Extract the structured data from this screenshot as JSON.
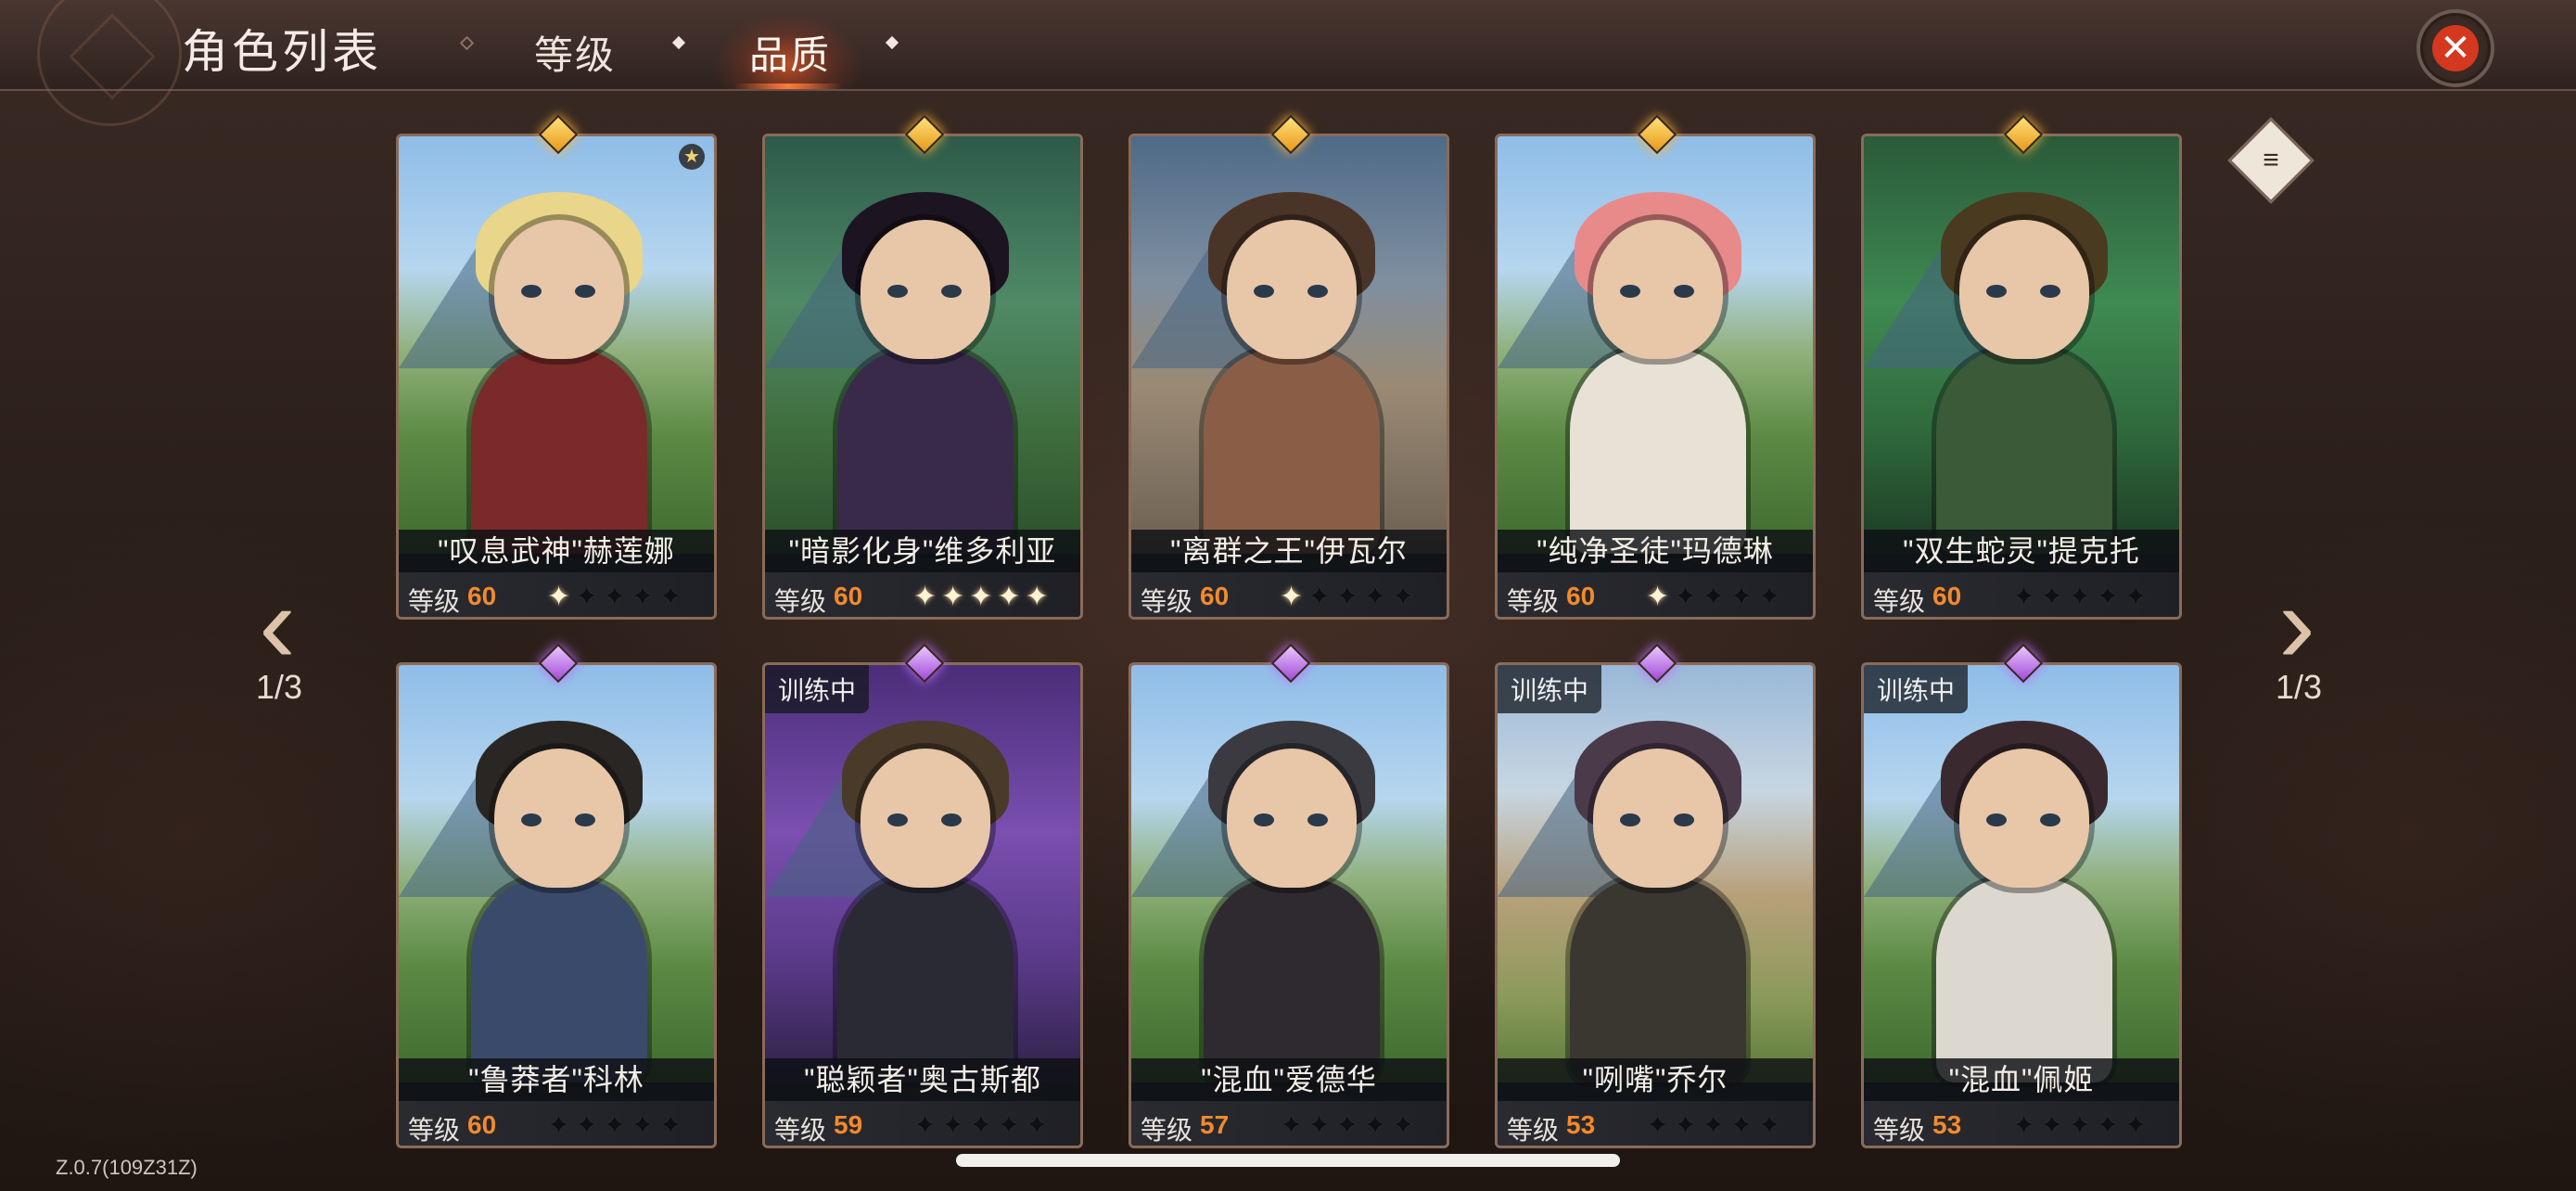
{
  "header": {
    "title": "角色列表",
    "tabs": [
      {
        "label": "等级",
        "active": false
      },
      {
        "label": "品质",
        "active": true
      }
    ],
    "close_label": "✕"
  },
  "pagination": {
    "left": "1/3",
    "right": "1/3"
  },
  "filter_icon": "≡",
  "level_label": "等级",
  "training_label": "训练中",
  "star_glyph": "✦",
  "colors": {
    "accent": "#f28a2c",
    "close": "#d4381e",
    "gem_gold": "#ffb43a",
    "gem_purple": "#a24bd8"
  },
  "cards": [
    {
      "name": "\"叹息武神\"赫莲娜",
      "level": "60",
      "stars_on": 1,
      "gem": "gold",
      "training": false,
      "theme": "sky",
      "hair": "#e9d68a",
      "body": "#7a2a28"
    },
    {
      "name": "\"暗影化身\"维多利亚",
      "level": "60",
      "stars_on": 5,
      "gem": "gold",
      "training": false,
      "theme": "forest",
      "hair": "#1c1420",
      "body": "#3a2a4a"
    },
    {
      "name": "\"离群之王\"伊瓦尔",
      "level": "60",
      "stars_on": 1,
      "gem": "gold",
      "training": false,
      "theme": "desert",
      "hair": "#4a3428",
      "body": "#8a5e46"
    },
    {
      "name": "\"纯净圣徒\"玛德琳",
      "level": "60",
      "stars_on": 1,
      "gem": "gold",
      "training": false,
      "theme": "sky",
      "hair": "#e88a8a",
      "body": "#e8e2d6"
    },
    {
      "name": "\"双生蛇灵\"提克托",
      "level": "60",
      "stars_on": 0,
      "gem": "gold",
      "training": false,
      "theme": "green",
      "hair": "#4a3a20",
      "body": "#3a5a38"
    },
    {
      "name": "\"鲁莽者\"科林",
      "level": "60",
      "stars_on": 0,
      "gem": "purple",
      "training": false,
      "theme": "sky",
      "hair": "#2a2624",
      "body": "#3a4a6a"
    },
    {
      "name": "\"聪颖者\"奥古斯都",
      "level": "59",
      "stars_on": 0,
      "gem": "purple",
      "training": true,
      "theme": "purple",
      "hair": "#4a3a2a",
      "body": "#2a2a34"
    },
    {
      "name": "\"混血\"爱德华",
      "level": "57",
      "stars_on": 0,
      "gem": "purple",
      "training": false,
      "theme": "sky",
      "hair": "#3a3a40",
      "body": "#2e2a30"
    },
    {
      "name": "\"咧嘴\"乔尔",
      "level": "53",
      "stars_on": 0,
      "gem": "purple",
      "training": true,
      "theme": "rocky",
      "hair": "#4a3a4a",
      "body": "#3a3630"
    },
    {
      "name": "\"混血\"佩姬",
      "level": "53",
      "stars_on": 0,
      "gem": "purple",
      "training": true,
      "theme": "sky",
      "hair": "#3a2a30",
      "body": "#dcd8d0"
    }
  ],
  "version": "Z.0.7(109Z31Z)"
}
